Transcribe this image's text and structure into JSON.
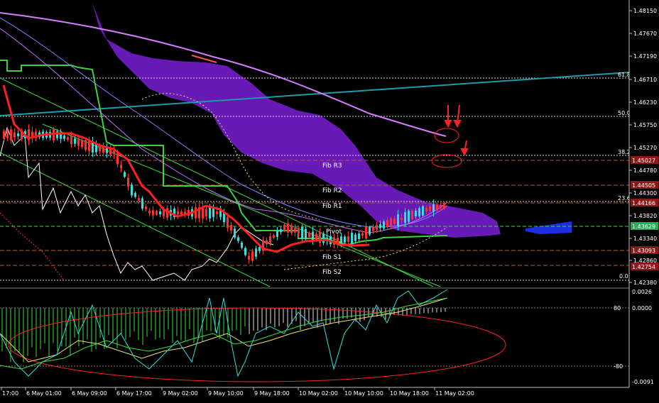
{
  "colors": {
    "background": "#000000",
    "axis": "#c0c0c0",
    "grid": "#404040",
    "cloud": "#7a1fd6",
    "cloud_blue": "#1b2ee0",
    "ma_long": "#d67cff",
    "trend": "#1e9aa8",
    "price_up": "#33dede",
    "price_down": "#ff3030",
    "fib_line": "#ffffff",
    "pivot_badge": "#8a1a1a",
    "current_badge": "#2ea85a",
    "green": "#3cdc3c",
    "yellow": "#e8e870",
    "red_ellipse": "#ff2020"
  },
  "main_axis": {
    "ticks": [
      "1.48150",
      "1.47670",
      "1.47190",
      "1.46710",
      "1.46230",
      "1.45750",
      "1.45270",
      "1.44780",
      "1.44300",
      "1.43820",
      "1.43340",
      "1.42860",
      "1.42380"
    ]
  },
  "price_badges": [
    {
      "name": "badge-fib-r3",
      "text": "1.45027",
      "kind": "pivot"
    },
    {
      "name": "badge-fib-r2",
      "text": "1.44505",
      "kind": "pivot"
    },
    {
      "name": "badge-fib-r1",
      "text": "1.44166",
      "kind": "pivot"
    },
    {
      "name": "badge-current",
      "text": "1.43629",
      "kind": "current"
    },
    {
      "name": "badge-fib-s1",
      "text": "1.43093",
      "kind": "pivot"
    },
    {
      "name": "badge-fib-s2",
      "text": "1.42754",
      "kind": "pivot"
    }
  ],
  "pivot_labels": [
    "Fib R3",
    "Fib R2",
    "Fib R1",
    "Pivot",
    "Fib S1",
    "Fib S2"
  ],
  "fib_retracement_labels": [
    "61.8",
    "50.0",
    "38.2",
    "23.6",
    "0.0"
  ],
  "sub_axis": {
    "ticks": [
      "0.0026",
      "0.0000",
      "-0.0091"
    ],
    "level_labels": [
      "80",
      "-80"
    ]
  },
  "time_axis": [
    "17:00",
    "6 May 01:00",
    "6 May 09:00",
    "6 May 17:00",
    "9 May 02:00",
    "9 May 10:00",
    "9 May 18:00",
    "10 May 02:00",
    "10 May 10:00",
    "10 May 18:00",
    "11 May 02:00"
  ]
}
